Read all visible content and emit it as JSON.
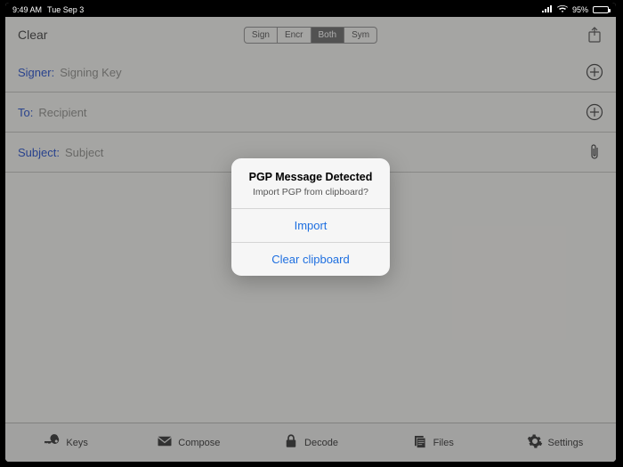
{
  "statusbar": {
    "time": "9:49 AM",
    "date": "Tue Sep 3",
    "battery": "95%"
  },
  "toolbar": {
    "clear_label": "Clear",
    "segments": {
      "sign": "Sign",
      "encr": "Encr",
      "both": "Both",
      "sym": "Sym"
    }
  },
  "fields": {
    "signer_label": "Signer:",
    "signer_placeholder": "Signing Key",
    "to_label": "To:",
    "to_placeholder": "Recipient",
    "subject_label": "Subject:",
    "subject_placeholder": "Subject"
  },
  "popup": {
    "title": "PGP Message Detected",
    "message": "Import PGP from clipboard?",
    "import_label": "Import",
    "clear_label": "Clear clipboard"
  },
  "tabs": {
    "keys": "Keys",
    "compose": "Compose",
    "decode": "Decode",
    "files": "Files",
    "settings": "Settings"
  }
}
